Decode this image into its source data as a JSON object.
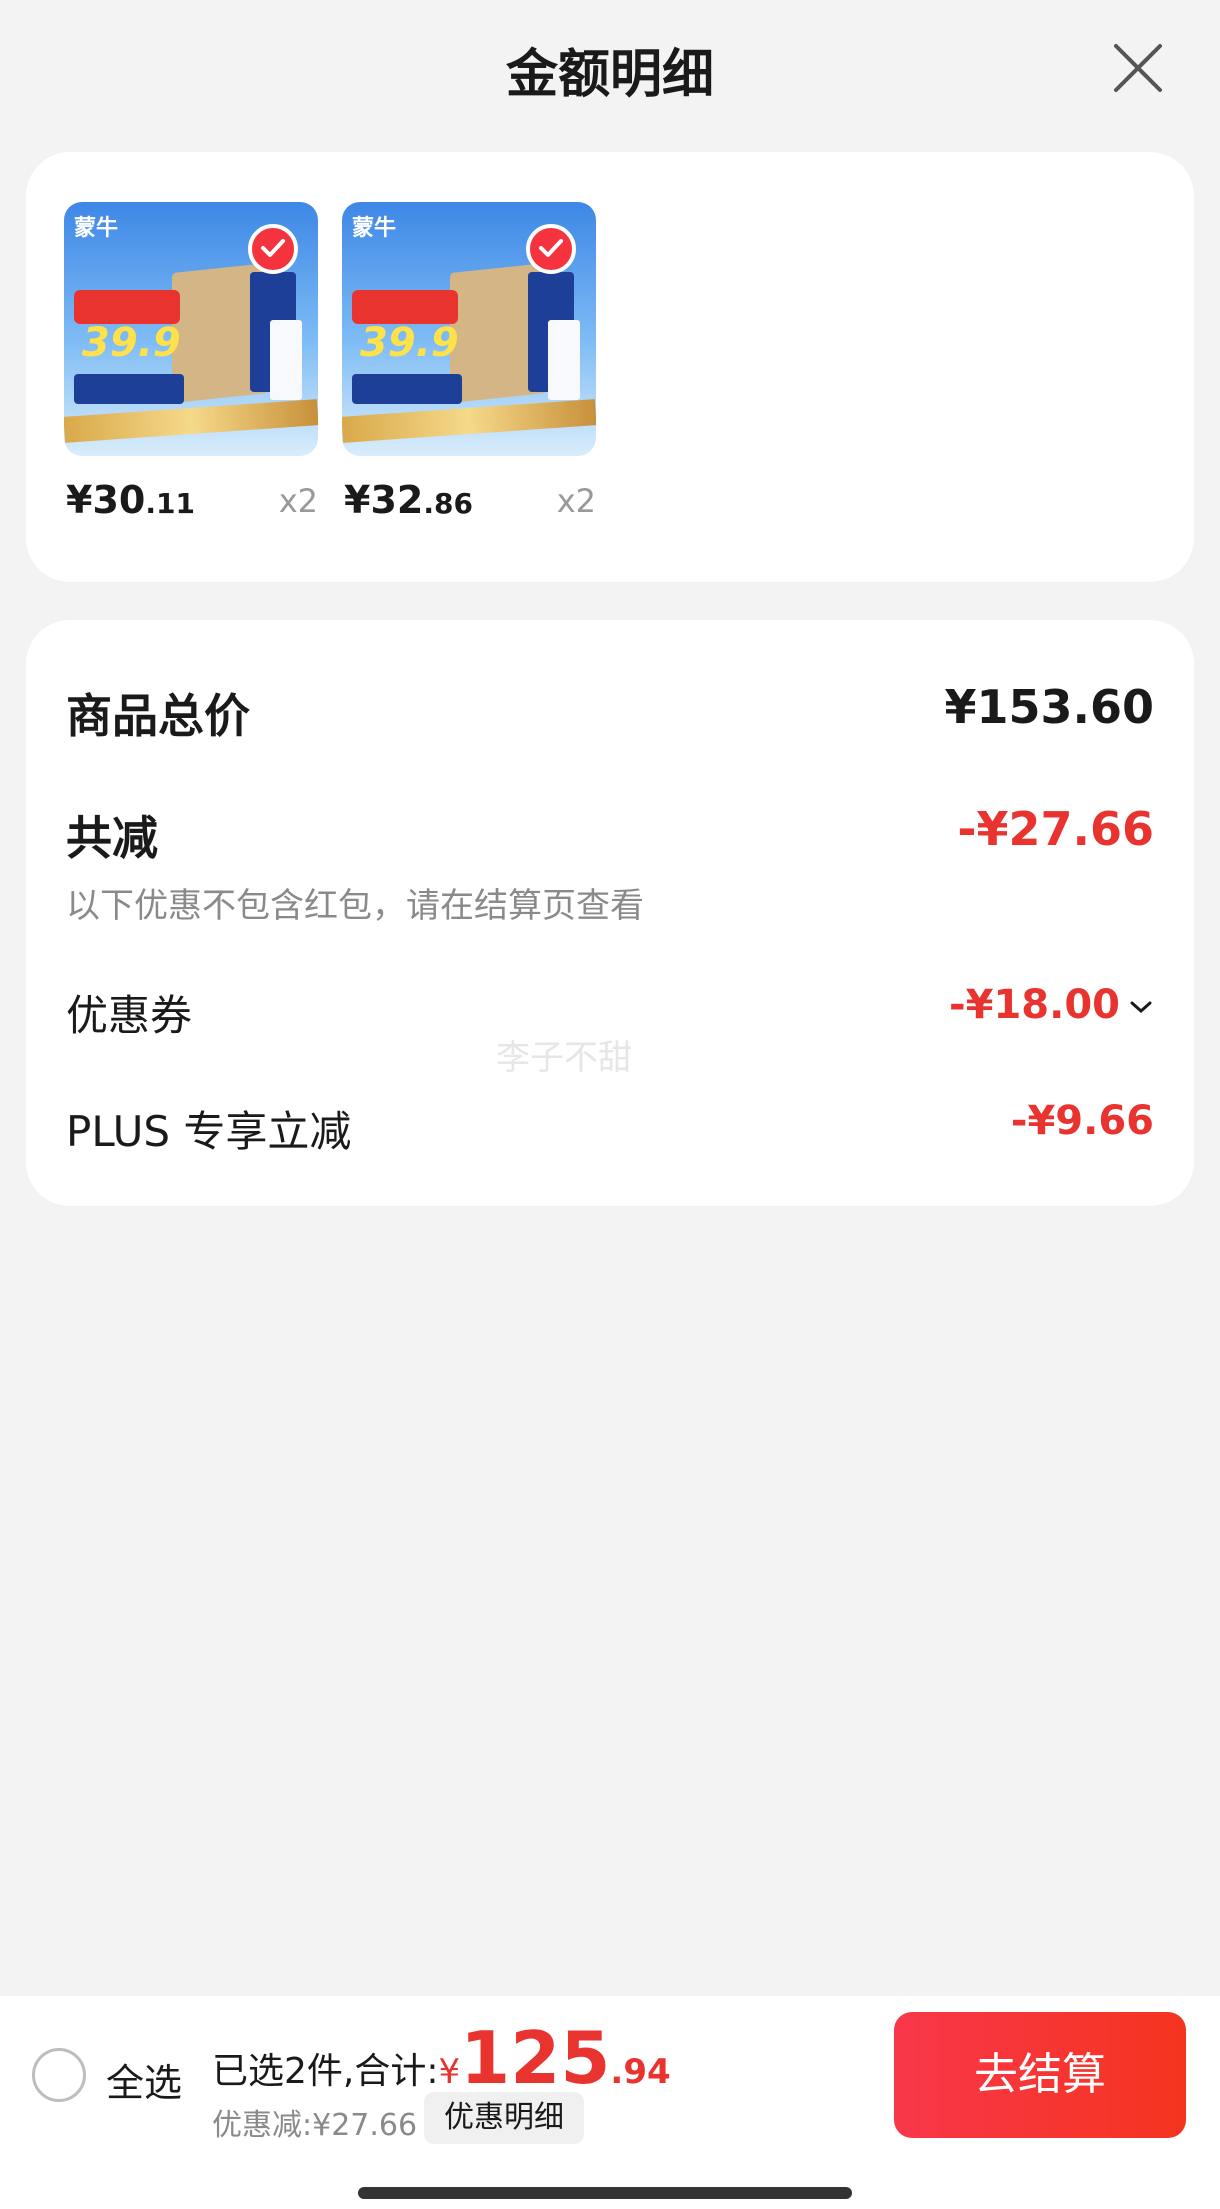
{
  "header": {
    "title": "金额明细",
    "close_icon": "close-icon"
  },
  "products": [
    {
      "brand": "蒙牛",
      "promo_price": "39.9",
      "price_main": "¥30",
      "price_decimal": ".11",
      "quantity": "x2",
      "selected": true
    },
    {
      "brand": "蒙牛",
      "promo_price": "39.9",
      "price_main": "¥32",
      "price_decimal": ".86",
      "quantity": "x2",
      "selected": true
    }
  ],
  "summary": {
    "total_label": "商品总价",
    "total_value": "¥153.60",
    "reduction_label": "共减",
    "reduction_value": "-¥27.66",
    "note": "以下优惠不包含红包，请在结算页查看",
    "coupon_label": "优惠券",
    "coupon_value": "-¥18.00",
    "plus_label": "PLUS 专享立减",
    "plus_value": "-¥9.66",
    "watermark": "李子不甜"
  },
  "bottom_bar": {
    "select_all": "全选",
    "selected_total_label": "已选2件,合计:",
    "currency": "¥",
    "total_integer": "125",
    "total_decimal": ".94",
    "discount_text": "优惠减:¥27.66",
    "detail_chip": "优惠明细",
    "checkout_button": "去结算"
  },
  "colors": {
    "accent_red": "#e8332f",
    "checkout_gradient_start": "#f8374a",
    "checkout_gradient_end": "#f5341f",
    "background": "#f3f3f3"
  }
}
